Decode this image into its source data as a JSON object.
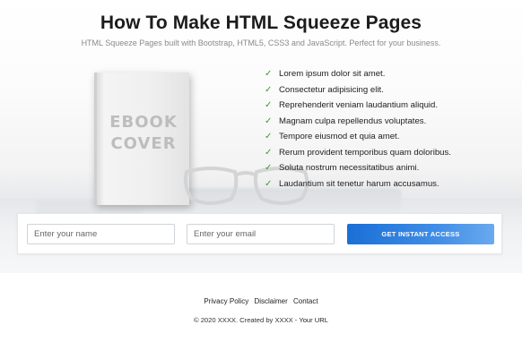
{
  "header": {
    "title": "How To Make HTML Squeeze Pages",
    "subtitle": "HTML Squeeze Pages built with Bootstrap, HTML5, CSS3 and JavaScript. Perfect for your business."
  },
  "ebook": {
    "line1": "EBOOK",
    "line2": "COVER"
  },
  "features": [
    "Lorem ipsum dolor sit amet.",
    "Consectetur adipisicing elit.",
    "Reprehenderit veniam laudantium aliquid.",
    "Magnam culpa repellendus voluptates.",
    "Tempore eiusmod et quia amet.",
    "Rerum provident temporibus quam doloribus.",
    "Soluta nostrum necessitatibus animi.",
    "Laudantium sit tenetur harum accusamus."
  ],
  "check_icon": "check-icon",
  "form": {
    "name_placeholder": "Enter your name",
    "email_placeholder": "Enter your email",
    "submit_label": "GET INSTANT ACCESS"
  },
  "footer": {
    "links": [
      "Privacy Policy",
      "Disclaimer",
      "Contact"
    ],
    "copyright_prefix": "© 2020 XXXX. Created by XXXX -",
    "copyright_link": "Your URL"
  },
  "colors": {
    "accent": "#1a6fd6",
    "check": "#3a9a2e"
  }
}
